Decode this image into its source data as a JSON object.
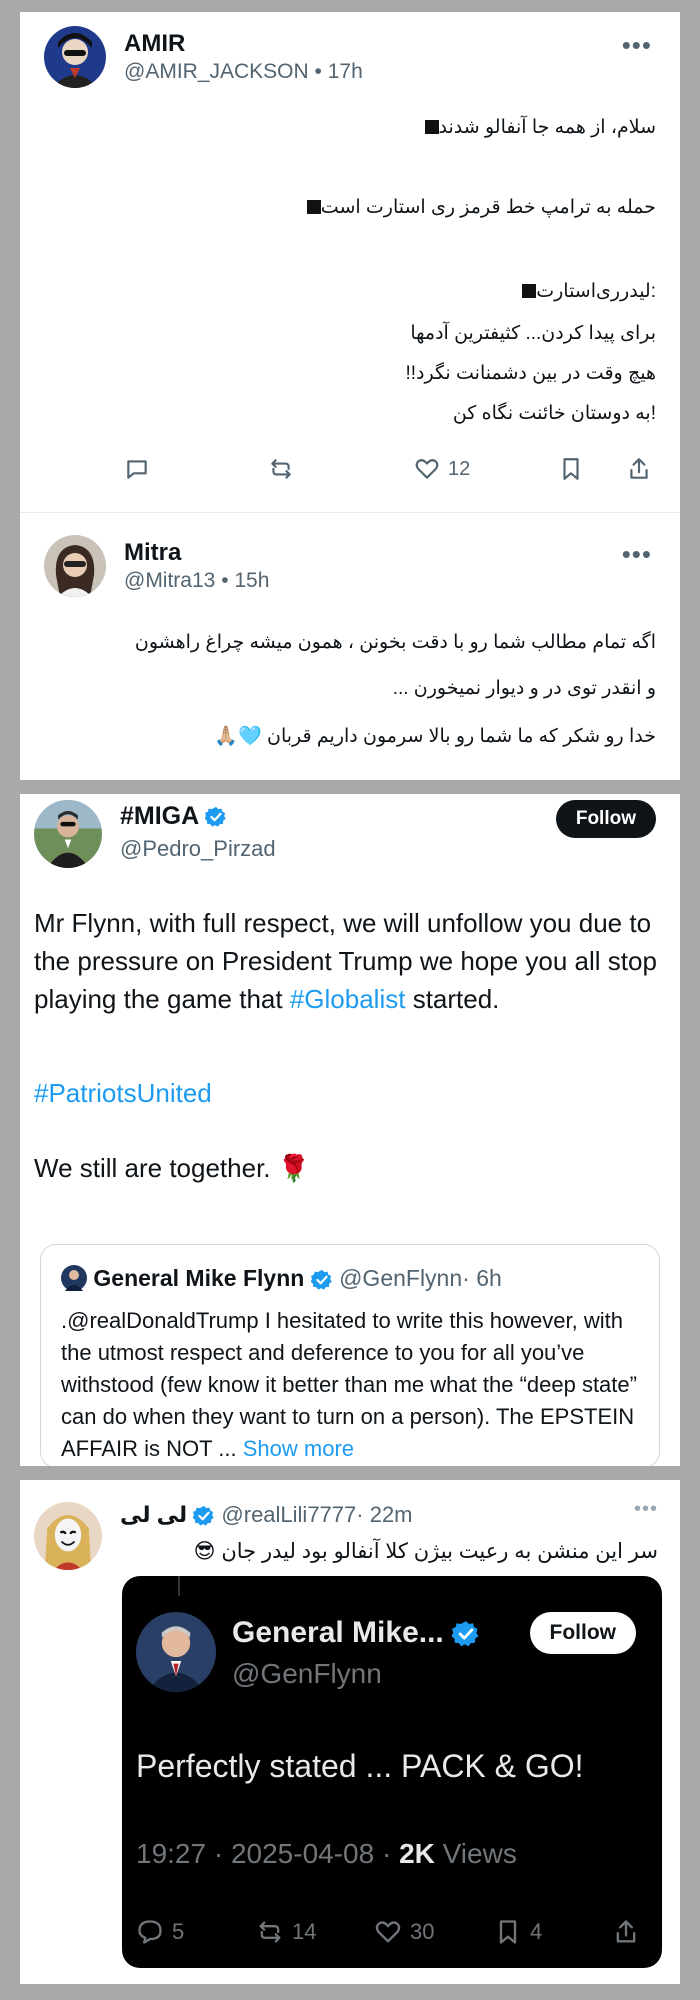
{
  "tweet1": {
    "name": "AMIR",
    "handle": "@AMIR_JACKSON",
    "time": "• 17h",
    "lines": [
      "سلام، از همه جا آنفالو شدند",
      "حمله به ترامپ خط قرمز ری استارت است",
      ":لیدرری‌استارت",
      "برای پیدا کردن... کثیفترین آدمها",
      "هیچ وقت در بین دشمنانت نگرد!!",
      "!به دوستان خائنت نگاه کن"
    ],
    "like_count": "12"
  },
  "tweet2": {
    "name": "Mitra",
    "handle": "@Mitra13",
    "time": "• 15h",
    "lines": [
      "اگه تمام مطالب شما رو با دقت بخونن ، همون میشه چراغ راهشون",
      "و انقدر توی در و دیوار نمیخورن ...",
      "خدا رو شکر که ما شما رو بالا سرمون داریم قربان 🩵🙏🏼"
    ]
  },
  "tweet3": {
    "name": "#MIGA",
    "handle": "@Pedro_Pirzad",
    "follow_label": "Follow",
    "body_part1": "Mr Flynn, with full respect, we will unfollow you due to the pressure on President Trump we hope you all stop playing the game that ",
    "hashtag1": "#Globalist",
    "body_part2": " started.",
    "hashtag2": "#PatriotsUnited",
    "closing": "We still are together. 🌹",
    "quote": {
      "name": "General Mike Flynn",
      "handle": "@GenFlynn",
      "time": "· 6h",
      "text": ".@realDonaldTrump I hesitated to write this however, with the utmost respect and deference to you for all you’ve withstood (few know it better than me what the “deep state” can do when they want to turn on a person). The EPSTEIN AFFAIR is NOT ... ",
      "show_more": "Show more"
    }
  },
  "tweet4": {
    "name": "لی لی",
    "handle": "@realLili7777",
    "time": "· 22m",
    "text": "سر این منشن به رعیت بیژن کلا آنفالو بود لیدر جان 😎",
    "embed": {
      "name": "General Mike...",
      "handle": "@GenFlynn",
      "follow_label": "Follow",
      "text": "Perfectly stated ... PACK & GO!",
      "time": "19:27 · 2025-04-08 · ",
      "views_count": "2K",
      "views_label": " Views",
      "replies": "5",
      "reposts": "14",
      "likes": "30",
      "bookmarks": "4"
    }
  },
  "colors": {
    "accent": "#1d9bf0",
    "text": "#0f1419",
    "muted": "#536471",
    "background": "#a9a9a9"
  }
}
